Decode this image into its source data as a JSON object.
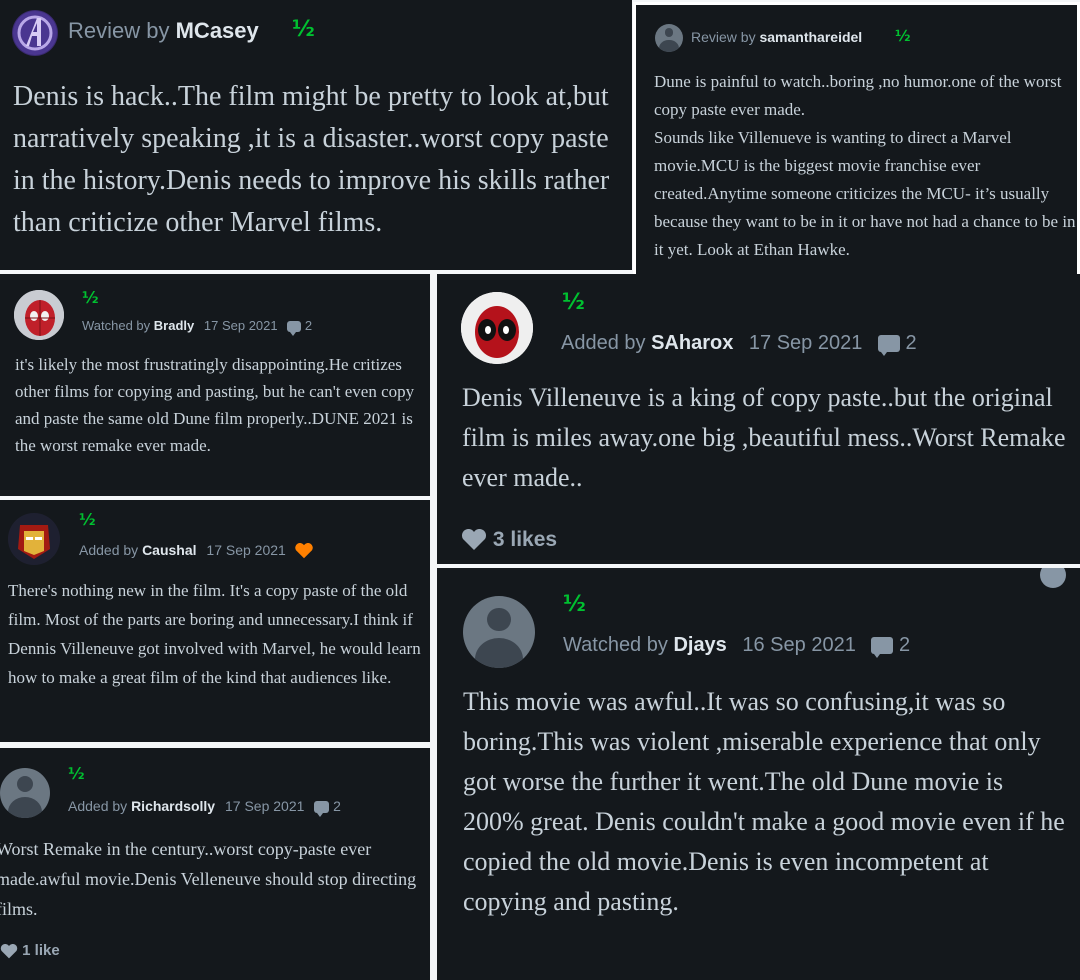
{
  "reviews": {
    "mcasey": {
      "prefix": "Review by",
      "user": "MCasey",
      "rating": "½",
      "text": "Denis is hack..The film might be pretty to look at,but narratively speaking ,it is a disaster..worst copy paste in the history.Denis needs to improve his skills rather than criticize other Marvel films."
    },
    "samanthareidel": {
      "prefix": "Review by",
      "user": "samanthareidel",
      "rating": "½",
      "text": "Dune is painful to watch..boring ,no humor.one of the worst copy paste ever made.",
      "text2": "Sounds like Villenueve is wanting to direct a Marvel movie.MCU is the biggest movie franchise ever created.Anytime someone criticizes the MCU- it’s usually because they want to be in it or have not had a chance to be in it yet. Look at Ethan Hawke."
    },
    "bradly": {
      "rating": "½",
      "prefix": "Watched by",
      "user": "Bradly",
      "date": "17 Sep 2021",
      "comments": "2",
      "text": "it's likely the most frustratingly disappointing.He critizes other films for copying and pasting, but he can't even copy and paste the same old Dune film properly..DUNE 2021 is the worst remake ever made."
    },
    "saharox": {
      "rating": "½",
      "prefix": "Added by",
      "user": "SAharox",
      "date": "17 Sep 2021",
      "comments": "2",
      "text": "Denis Villeneuve is a king of copy paste..but the original film is miles away.one big ,beautiful mess..Worst Remake ever made..",
      "likes": "3 likes"
    },
    "caushal": {
      "rating": "½",
      "prefix": "Added by",
      "user": "Caushal",
      "date": "17 Sep 2021",
      "liked": true,
      "text": "There's nothing new in the film. It's a copy paste of the old film. Most of the parts are boring and unnecessary.I think if Dennis Villeneuve got involved with Marvel, he would learn how to make a great film of the kind that audiences like."
    },
    "djays": {
      "rating": "½",
      "prefix": "Watched by",
      "user": "Djays",
      "date": "16 Sep 2021",
      "comments": "2",
      "text": "This movie was awful..It was so confusing,it was so boring.This was violent ,miserable experience that only got worse the further it went.The old Dune movie is 200% great. Denis couldn't make a good movie even if he copied the old movie.Denis is even incompetent at copying and pasting."
    },
    "richardsolly": {
      "rating": "½",
      "prefix": "Added by",
      "user": "Richardsolly",
      "date": "17 Sep 2021",
      "comments": "2",
      "text": "Worst Remake in the century..worst copy-paste ever made.awful movie.Denis Velleneuve should stop directing films.",
      "likes": "1 like"
    }
  },
  "colors": {
    "card_bg": "#14181c",
    "rating_green": "#00c030",
    "meta_gray": "#8796a5",
    "username": "#dfe6ec",
    "body_text": "#c8d2da",
    "like_orange": "#ff8000"
  },
  "icons": [
    "comment-icon",
    "heart-icon",
    "liked-heart-icon",
    "avatar-icon"
  ]
}
